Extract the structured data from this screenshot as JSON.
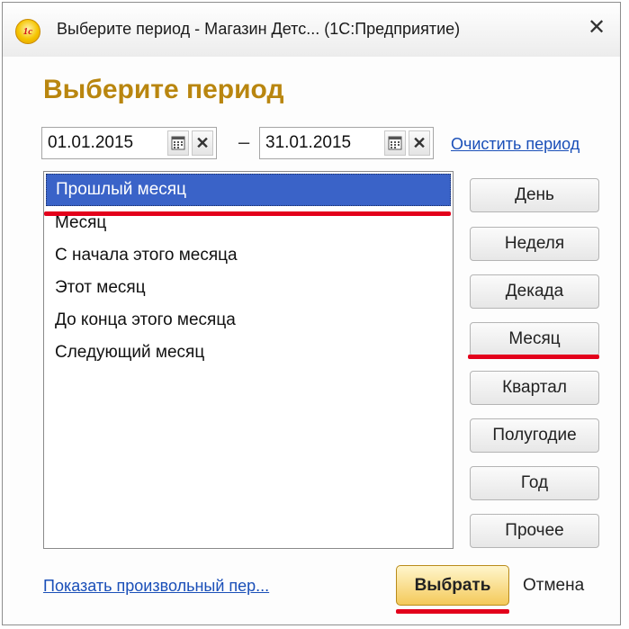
{
  "window": {
    "title": "Выберите период - Магазин Детс... (1С:Предприятие)",
    "app_icon_text": "1c",
    "close_glyph": "✕"
  },
  "heading": "Выберите период",
  "period": {
    "start": "01.01.2015",
    "end": "31.01.2015",
    "separator": "–",
    "clear_glyph": "✕",
    "clear_link": "Очистить период"
  },
  "list": {
    "items": [
      "Прошлый месяц",
      "Месяц",
      "С начала этого месяца",
      "Этот месяц",
      "До конца этого месяца",
      "Следующий месяц"
    ],
    "selected_index": 0
  },
  "side_buttons": [
    "День",
    "Неделя",
    "Декада",
    "Месяц",
    "Квартал",
    "Полугодие",
    "Год",
    "Прочее"
  ],
  "footer": {
    "custom_period_link": "Показать произвольный пер...",
    "choose_label": "Выбрать",
    "cancel_label": "Отмена"
  },
  "colors": {
    "heading": "#b9860f",
    "selection": "#3a63c8",
    "highlight_marks": "#e3001b",
    "link": "#1a4fb8"
  }
}
